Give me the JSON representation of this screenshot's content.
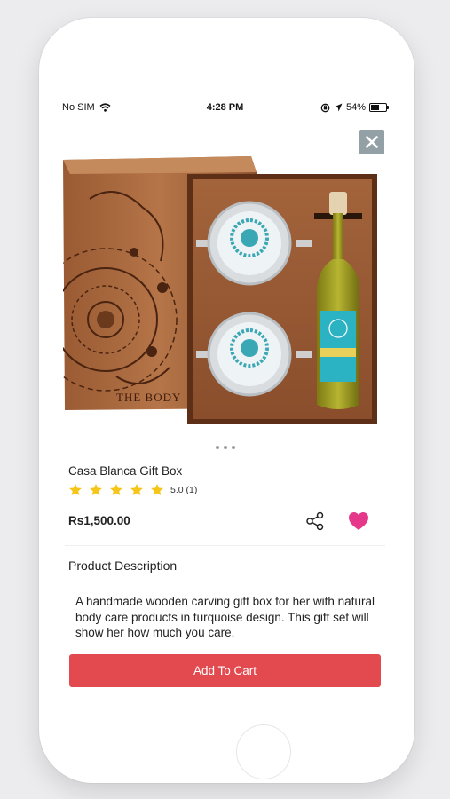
{
  "status_bar": {
    "carrier": "No SIM",
    "time": "4:28 PM",
    "battery_percent": "54%",
    "battery_level": 0.54,
    "icons": [
      "wifi-icon",
      "orientation-lock-icon",
      "location-arrow-icon",
      "battery-icon"
    ]
  },
  "close_icon": "close-icon",
  "gallery": {
    "page_count": 3,
    "current_page": 1
  },
  "product": {
    "title": "Casa Blanca Gift Box",
    "rating_value": 5,
    "rating_text": "5.0 (1)",
    "price": "Rs1,500.00",
    "star_color": "#f5c518",
    "heart_color": "#e6388a"
  },
  "actions": {
    "share_icon": "share-icon",
    "favorite_icon": "heart-icon"
  },
  "description": {
    "heading": "Product Description",
    "text": "A handmade wooden carving gift box for her with natural body care products in turquoise design. This gift set will show her how much you care."
  },
  "cart_button": {
    "label": "Add To Cart",
    "color": "#e24a4f"
  }
}
